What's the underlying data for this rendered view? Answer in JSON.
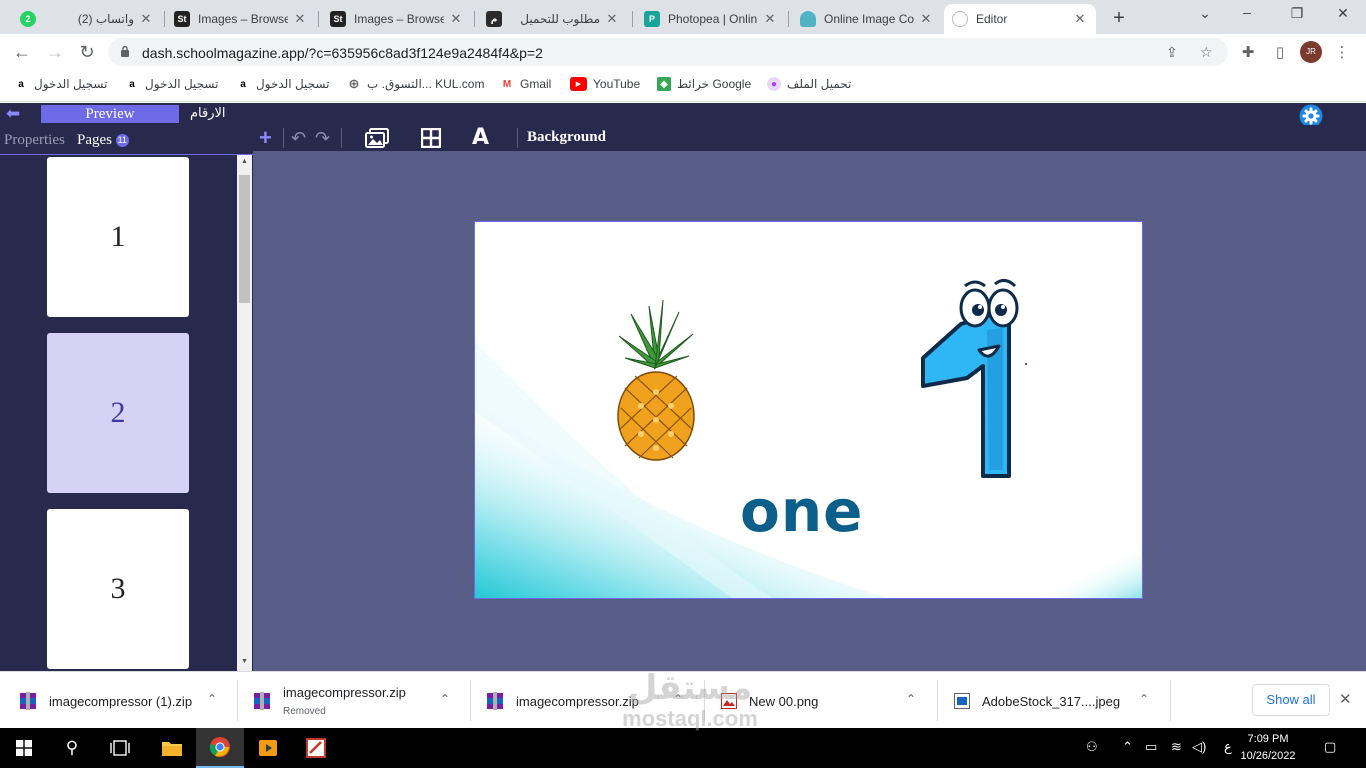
{
  "browser": {
    "tabs": [
      {
        "title": "(2) واتساب",
        "icon": "whatsapp-icon",
        "badge": "2"
      },
      {
        "title": "Images – Browse",
        "icon": "stock-icon"
      },
      {
        "title": "Images – Browse",
        "icon": "stock-icon"
      },
      {
        "title": "مطلوب للتحميل",
        "icon": "mostaql-icon"
      },
      {
        "title": "Photopea | Onlin",
        "icon": "photopea-icon"
      },
      {
        "title": "Online Image Co",
        "icon": "compressor-icon"
      },
      {
        "title": "Editor",
        "icon": "editor-icon",
        "active": true
      }
    ],
    "url": "dash.schoolmagazine.app/?c=635956c8ad3f124e9a2484f4&p=2",
    "bookmarks": [
      {
        "label": "تسجيل الدخول",
        "icon": "amazon-icon"
      },
      {
        "label": "تسجيل الدخول",
        "icon": "amazon-icon"
      },
      {
        "label": "تسجيل الدخول",
        "icon": "amazon-icon"
      },
      {
        "label": "التسوق. ب... KUL.com",
        "icon": "globe-icon"
      },
      {
        "label": "Gmail",
        "icon": "gmail-icon"
      },
      {
        "label": "YouTube",
        "icon": "youtube-icon"
      },
      {
        "label": "خرائط Google",
        "icon": "maps-icon"
      },
      {
        "label": "تحميل الملف",
        "icon": "file-icon"
      }
    ]
  },
  "app": {
    "preview_label": "Preview",
    "arabic_title": "الارقام",
    "side_tabs": {
      "properties": "Properties",
      "pages": "Pages",
      "pages_count": "11"
    },
    "toolbar": {
      "background_label": "Background"
    },
    "pages": [
      {
        "number": "1",
        "selected": false
      },
      {
        "number": "2",
        "selected": true
      },
      {
        "number": "3",
        "selected": false
      }
    ],
    "canvas": {
      "word": "one"
    }
  },
  "downloads": {
    "items": [
      {
        "name": "imagecompressor (1).zip",
        "status": ""
      },
      {
        "name": "imagecompressor.zip",
        "status": "Removed"
      },
      {
        "name": "imagecompressor.zip",
        "status": ""
      },
      {
        "name": "New 00.png",
        "status": ""
      },
      {
        "name": "AdobeStock_317....jpeg",
        "status": ""
      }
    ],
    "show_all": "Show all"
  },
  "taskbar": {
    "time": "7:09 PM",
    "date": "10/26/2022",
    "lang": "ع"
  },
  "watermark": {
    "arabic": "مستقل",
    "latin": "mostaql.com"
  },
  "colors": {
    "accent": "#6f6ae6",
    "app_dark": "#272a4c",
    "workspace": "#585d87"
  }
}
